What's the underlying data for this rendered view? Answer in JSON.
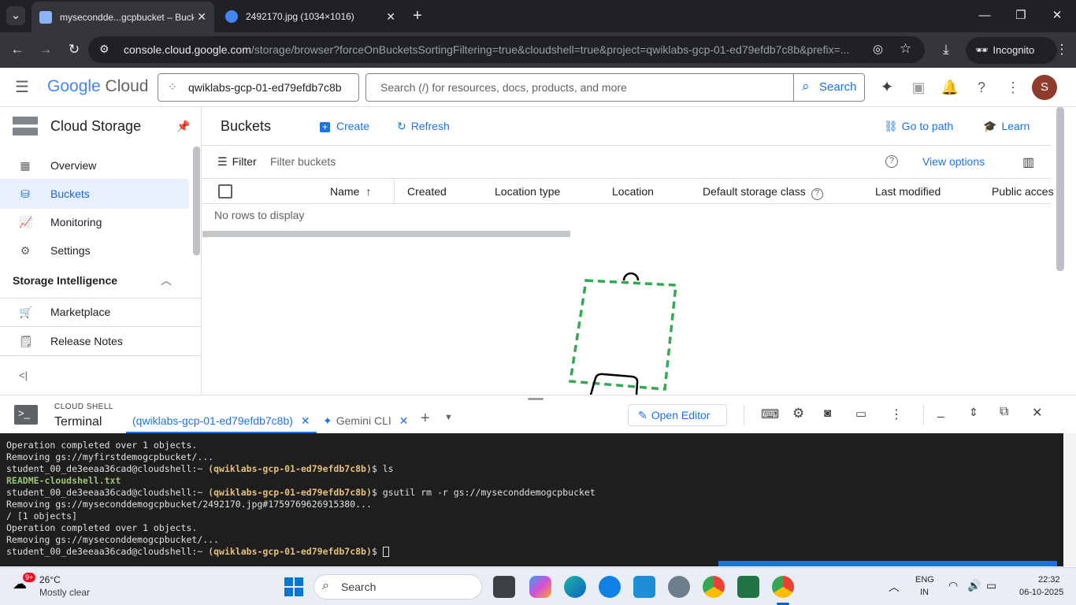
{
  "browser": {
    "tabs": [
      {
        "title": "myseconddе...gcpbucket – Buck",
        "active": true
      },
      {
        "title": "2492170.jpg (1034×1016)",
        "active": false
      }
    ],
    "url_main": "console.cloud.google.com",
    "url_rest": "/storage/browser?forceOnBucketsSortingFiltering=true&cloudshell=true&project=qwiklabs-gcp-01-ed79efdb7c8b&prefix=...",
    "incognito_label": "Incognito"
  },
  "gcp": {
    "logo_google": "Google",
    "logo_cloud": " Cloud",
    "project": "qwiklabs-gcp-01-ed79efdb7c8b",
    "search_placeholder": "Search (/) for resources, docs, products, and more",
    "search_button": "Search",
    "avatar_letter": "S"
  },
  "sidebar": {
    "title": "Cloud Storage",
    "items": [
      {
        "label": "Overview"
      },
      {
        "label": "Buckets"
      },
      {
        "label": "Monitoring"
      },
      {
        "label": "Settings"
      }
    ],
    "section": "Storage Intelligence",
    "extra": [
      {
        "label": "Marketplace"
      },
      {
        "label": "Release Notes"
      }
    ],
    "collapse": "<|"
  },
  "main": {
    "title": "Buckets",
    "create": "Create",
    "refresh": "Refresh",
    "go_to_path": "Go to path",
    "learn": "Learn",
    "filter_label": "Filter",
    "filter_placeholder": "Filter buckets",
    "view_options": "View options",
    "columns": [
      "Name",
      "Created",
      "Location type",
      "Location",
      "Default storage class",
      "Last modified",
      "Public acces"
    ],
    "empty": "No rows to display"
  },
  "shell": {
    "caption": "CLOUD SHELL",
    "title": "Terminal",
    "tab1": "(qwiklabs-gcp-01-ed79efdb7c8b)",
    "tab2": "Gemini CLI",
    "open_editor": "Open Editor",
    "lines": [
      {
        "plain": "Operation completed over 1 objects."
      },
      {
        "plain": "Removing gs://myfirstdemogcpbucket/..."
      },
      {
        "prompt": "student_00_de3eeaa36cad@cloudshell:~ ",
        "proj": "(qwiklabs-gcp-01-ed79efdb7c8b)",
        "cmd": "$ ls"
      },
      {
        "green": "README-cloudshell.txt"
      },
      {
        "prompt": "student_00_de3eeaa36cad@cloudshell:~ ",
        "proj": "(qwiklabs-gcp-01-ed79efdb7c8b)",
        "cmd": "$ gsutil rm -r gs://myseconddemogcpbucket"
      },
      {
        "plain": "Removing gs://myseconddemogcpbucket/2492170.jpg#1759769626915380..."
      },
      {
        "plain": "/ [1 objects]"
      },
      {
        "plain": "Operation completed over 1 objects."
      },
      {
        "plain": "Removing gs://myseconddemogcpbucket/..."
      },
      {
        "prompt": "student_00_de3eeaa36cad@cloudshell:~ ",
        "proj": "(qwiklabs-gcp-01-ed79efdb7c8b)",
        "cmd": "$ "
      }
    ]
  },
  "taskbar": {
    "temp": "26°C",
    "weather": "Mostly clear",
    "badge": "9+",
    "search": "Search",
    "lang1": "ENG",
    "lang2": "IN",
    "time": "22:32",
    "date": "06-10-2025"
  }
}
